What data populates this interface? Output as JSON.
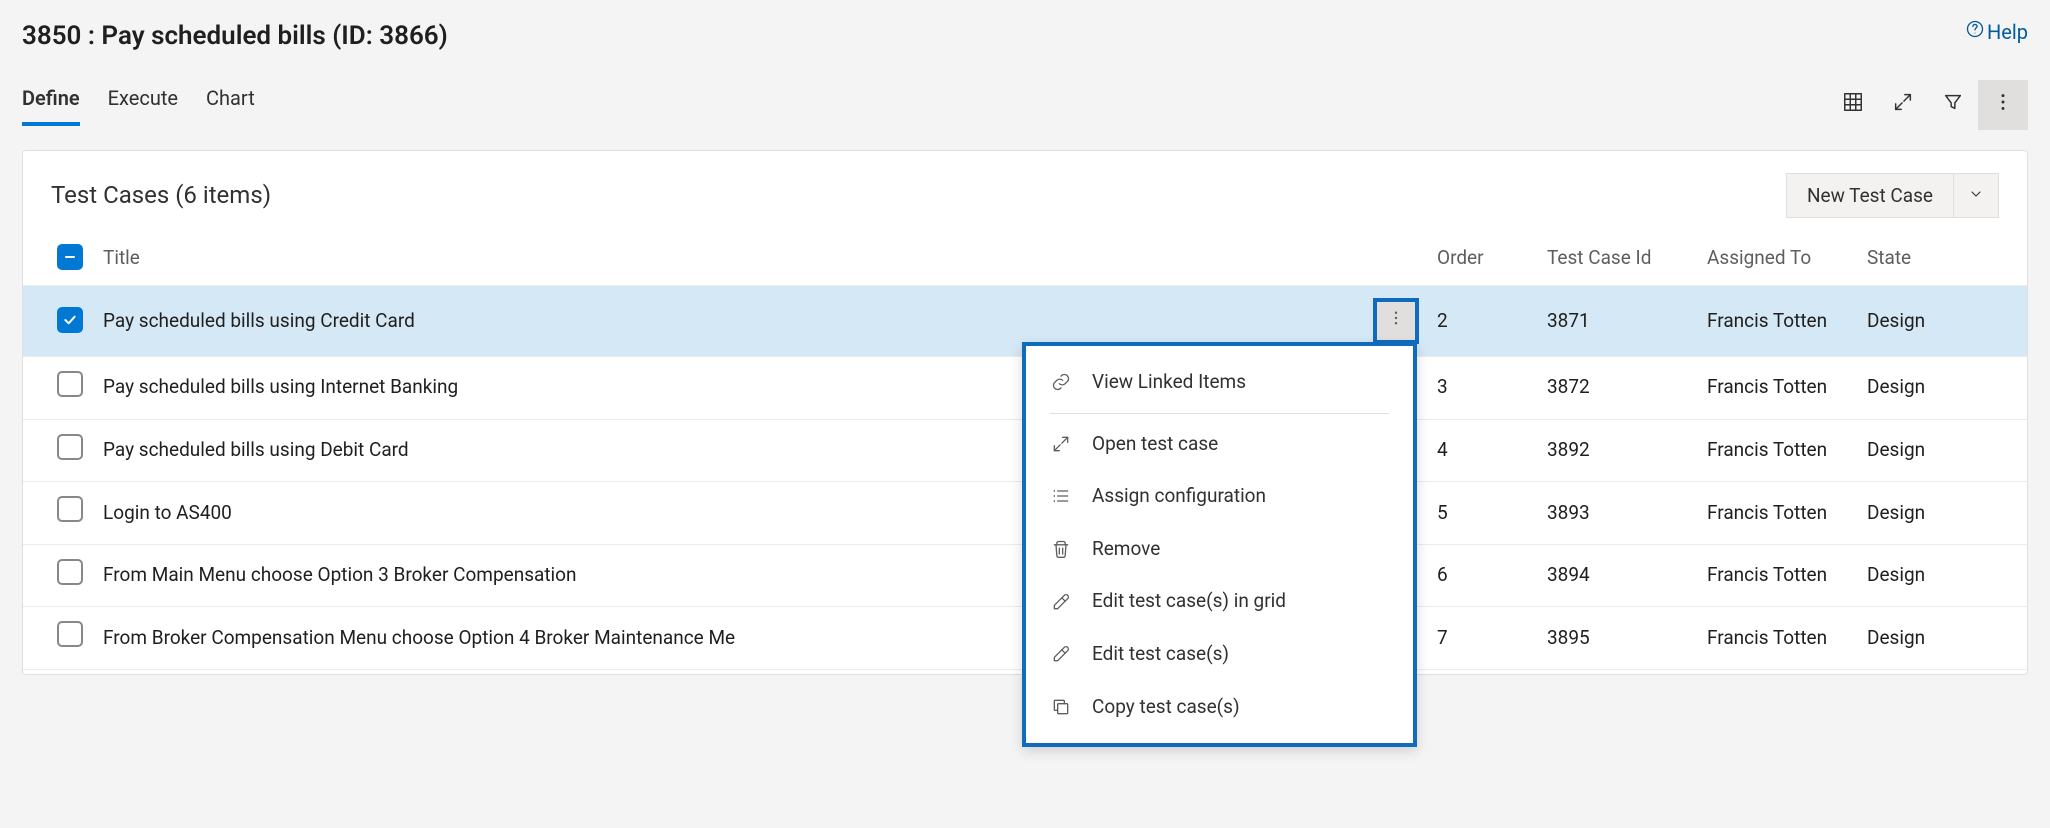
{
  "header": {
    "title": "3850 : Pay scheduled bills (ID: 3866)",
    "help_label": "Help"
  },
  "tabs": {
    "items": [
      {
        "label": "Define",
        "active": true
      },
      {
        "label": "Execute",
        "active": false
      },
      {
        "label": "Chart",
        "active": false
      }
    ]
  },
  "panel": {
    "title": "Test Cases (6 items)",
    "new_button_label": "New Test Case"
  },
  "columns": {
    "title": "Title",
    "order": "Order",
    "test_case_id": "Test Case Id",
    "assigned_to": "Assigned To",
    "state": "State"
  },
  "rows": [
    {
      "selected": true,
      "title": "Pay scheduled bills using Credit Card",
      "order": "2",
      "id": "3871",
      "assigned": "Francis Totten",
      "state": "Design"
    },
    {
      "selected": false,
      "title": "Pay scheduled bills using Internet Banking",
      "order": "3",
      "id": "3872",
      "assigned": "Francis Totten",
      "state": "Design"
    },
    {
      "selected": false,
      "title": "Pay scheduled bills using Debit Card",
      "order": "4",
      "id": "3892",
      "assigned": "Francis Totten",
      "state": "Design"
    },
    {
      "selected": false,
      "title": "Login to AS400",
      "order": "5",
      "id": "3893",
      "assigned": "Francis Totten",
      "state": "Design"
    },
    {
      "selected": false,
      "title": "From Main Menu choose Option 3 Broker Compensation",
      "order": "6",
      "id": "3894",
      "assigned": "Francis Totten",
      "state": "Design"
    },
    {
      "selected": false,
      "title": "From Broker Compensation Menu choose Option 4 Broker Maintenance Me",
      "order": "7",
      "id": "3895",
      "assigned": "Francis Totten",
      "state": "Design"
    }
  ],
  "context_menu": {
    "items": [
      {
        "icon": "link",
        "label": "View Linked Items",
        "separator_after": true
      },
      {
        "icon": "expand",
        "label": "Open test case"
      },
      {
        "icon": "list",
        "label": "Assign configuration"
      },
      {
        "icon": "trash",
        "label": "Remove"
      },
      {
        "icon": "pencil",
        "label": "Edit test case(s) in grid"
      },
      {
        "icon": "pencil",
        "label": "Edit test case(s)"
      },
      {
        "icon": "copy",
        "label": "Copy test case(s)"
      }
    ]
  }
}
